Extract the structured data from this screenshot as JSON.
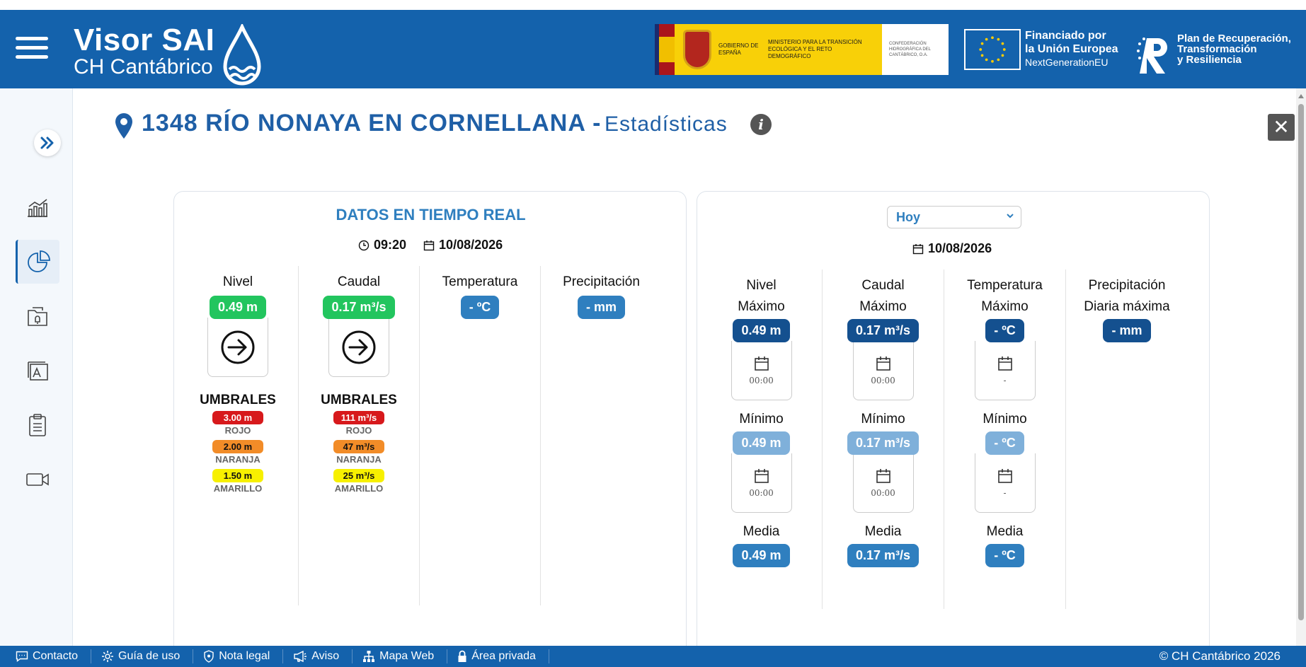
{
  "header": {
    "brand_title": "Visor SAI",
    "brand_subtitle": "CH Cantábrico",
    "gov_text": "GOBIERNO DE ESPAÑA",
    "ministry_text": "MINISTERIO PARA LA TRANSICIÓN ECOLÓGICA Y EL RETO DEMOGRÁFICO",
    "confed_text": "CONFEDERACIÓN HIDROGRÁFICA DEL CANTÁBRICO, O.A.",
    "eu_line1": "Financiado por",
    "eu_line2": "la Unión Europea",
    "eu_line3": "NextGenerationEU",
    "prtr_line1": "Plan de Recuperación,",
    "prtr_line2": "Transformación",
    "prtr_line3": "y Resiliencia"
  },
  "page": {
    "station": "1348 RÍO NONAYA EN CORNELLANA -",
    "section": "Estadísticas"
  },
  "realtime": {
    "title": "DATOS EN TIEMPO REAL",
    "time": "09:20",
    "date": "10/08/2026",
    "nivel": {
      "label": "Nivel",
      "value": "0.49 m",
      "trend": "arrow-right-icon"
    },
    "caudal": {
      "label": "Caudal",
      "value": "0.17 m³/s",
      "trend": "arrow-right-icon"
    },
    "temperatura": {
      "label": "Temperatura",
      "value": "- ºC"
    },
    "precipitacion": {
      "label": "Precipitación",
      "value": "- mm"
    },
    "umbrales_title": "UMBRALES",
    "nivel_thresholds": [
      {
        "value": "3.00 m",
        "label": "ROJO",
        "color": "#d7191c"
      },
      {
        "value": "2.00 m",
        "label": "NARANJA",
        "color": "#f28c28"
      },
      {
        "value": "1.50 m",
        "label": "AMARILLO",
        "color": "#f7f000"
      }
    ],
    "caudal_thresholds": [
      {
        "value": "111 m³/s",
        "label": "ROJO",
        "color": "#d7191c"
      },
      {
        "value": "47 m³/s",
        "label": "NARANJA",
        "color": "#f28c28"
      },
      {
        "value": "25 m³/s",
        "label": "AMARILLO",
        "color": "#f7f000"
      }
    ]
  },
  "stats": {
    "period": "Hoy",
    "date": "10/08/2026",
    "labels": {
      "max": "Máximo",
      "min": "Mínimo",
      "avg": "Media",
      "daily_max": "Diaria máxima"
    },
    "nivel": {
      "label": "Nivel",
      "max": "0.49 m",
      "max_time": "00:00",
      "min": "0.49 m",
      "min_time": "00:00",
      "avg": "0.49 m"
    },
    "caudal": {
      "label": "Caudal",
      "max": "0.17 m³/s",
      "max_time": "00:00",
      "min": "0.17 m³/s",
      "min_time": "00:00",
      "avg": "0.17 m³/s"
    },
    "temperatura": {
      "label": "Temperatura",
      "max": "- ºC",
      "max_time": "-",
      "min": "- ºC",
      "min_time": "-",
      "avg": "- ºC"
    },
    "precipitacion": {
      "label": "Precipitación",
      "daily_max": "- mm"
    }
  },
  "footer": {
    "items": [
      "Contacto",
      "Guía de uso",
      "Nota legal",
      "Aviso",
      "Mapa Web",
      "Área privada"
    ],
    "copyright": "© CH Cantábrico 2026"
  },
  "colors": {
    "header": "#1462ac",
    "accent": "#2f7fbf",
    "green": "#22c55e",
    "dark_blue": "#14508f",
    "light_blue": "#7fb0da"
  }
}
